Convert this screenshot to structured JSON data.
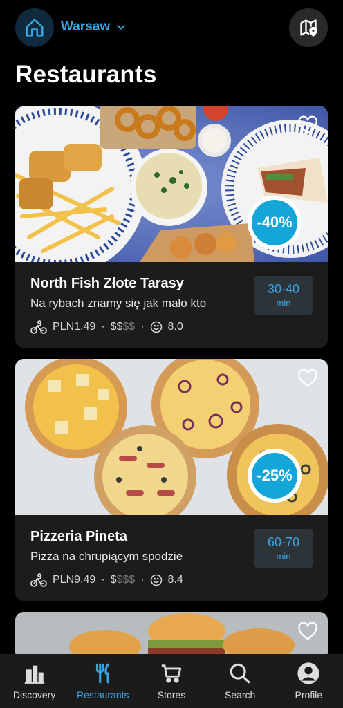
{
  "header": {
    "city": "Warsaw",
    "title": "Restaurants"
  },
  "restaurants": [
    {
      "name": "North Fish Złote Tarasy",
      "description": "Na rybach znamy się jak mało kto",
      "delivery_fee": "PLN1.49",
      "price_level_active": "$$",
      "price_level_dim": "$$",
      "rating": "8.0",
      "eta_range": "30-40",
      "eta_unit": "min",
      "discount": "-40%"
    },
    {
      "name": "Pizzeria Pineta",
      "description": "Pizza na chrupiącym spodzie",
      "delivery_fee": "PLN9.49",
      "price_level_active": "$",
      "price_level_dim": "$$$",
      "rating": "8.4",
      "eta_range": "60-70",
      "eta_unit": "min",
      "discount": "-25%"
    }
  ],
  "bottom_nav": [
    {
      "label": "Discovery"
    },
    {
      "label": "Restaurants"
    },
    {
      "label": "Stores"
    },
    {
      "label": "Search"
    },
    {
      "label": "Profile"
    }
  ],
  "colors": {
    "accent": "#3aa6e3",
    "discount_badge": "#14a6d8",
    "card_bg": "#1c1c1c"
  }
}
